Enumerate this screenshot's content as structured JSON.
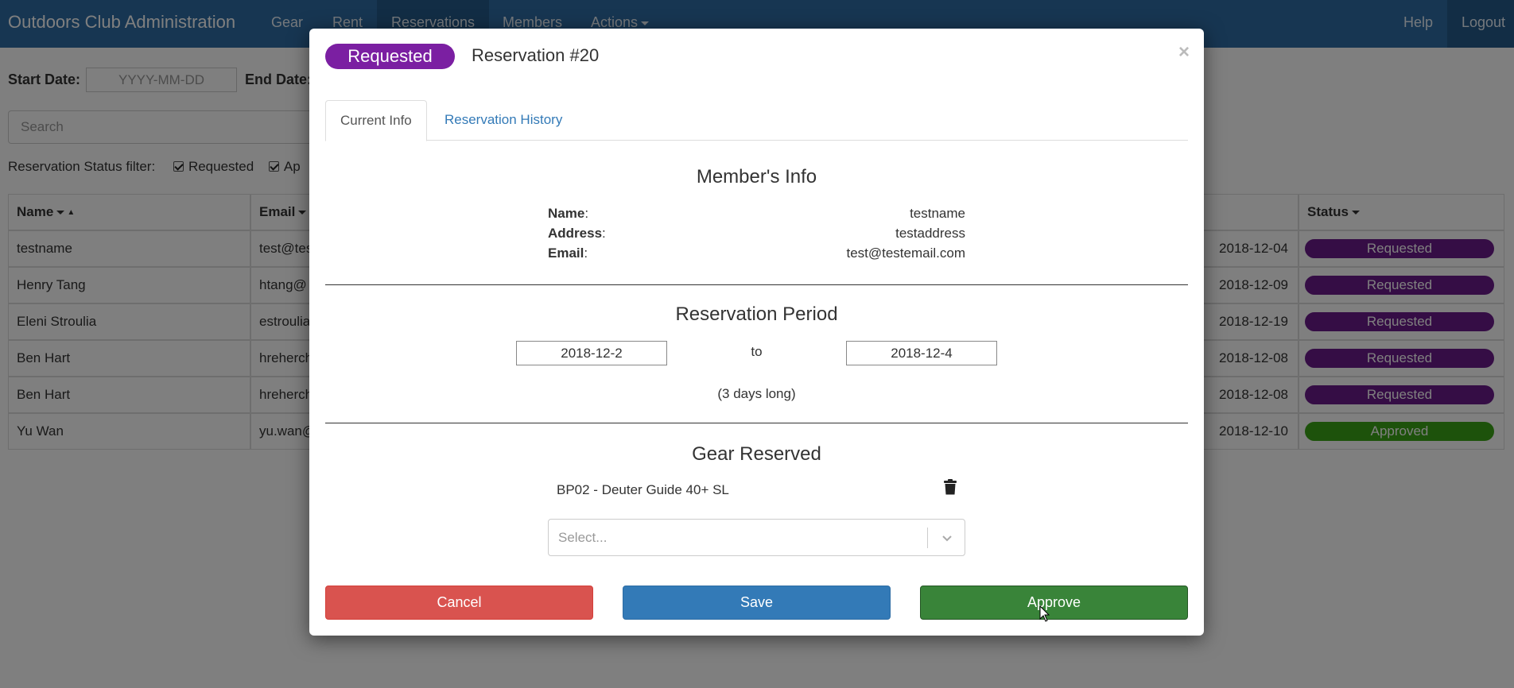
{
  "nav": {
    "brand": "Outdoors Club Administration",
    "items": [
      "Gear",
      "Rent",
      "Reservations",
      "Members",
      "Actions"
    ],
    "help": "Help",
    "logout": "Logout"
  },
  "filters": {
    "start_label": "Start Date:",
    "start_placeholder": "YYYY-MM-DD",
    "end_label": "End Date:",
    "search_placeholder": "Search",
    "status_filter_label": "Reservation Status filter:",
    "status_options": [
      "Requested",
      "Ap"
    ]
  },
  "table": {
    "headers": {
      "name": "Name",
      "email": "Email",
      "status": "Status"
    },
    "rows": [
      {
        "name": "testname",
        "email": "test@tes",
        "date": "2018-12-04",
        "status": "Requested"
      },
      {
        "name": "Henry Tang",
        "email": "htang@",
        "date": "2018-12-09",
        "status": "Requested"
      },
      {
        "name": "Eleni Stroulia",
        "email": "estroulia",
        "date": "2018-12-19",
        "status": "Requested"
      },
      {
        "name": "Ben Hart",
        "email": "hreherch",
        "date": "2018-12-08",
        "status": "Requested"
      },
      {
        "name": "Ben Hart",
        "email": "hreherch",
        "date": "2018-12-08",
        "status": "Requested"
      },
      {
        "name": "Yu Wan",
        "email": "yu.wan@",
        "date": "2018-12-10",
        "status": "Approved"
      }
    ]
  },
  "colors": {
    "requested": "#6a1b8a",
    "approved": "#3aa517",
    "navbar": "#2e6da4"
  },
  "modal": {
    "status": "Requested",
    "title": "Reservation #20",
    "close": "×",
    "tabs": {
      "current": "Current Info",
      "history": "Reservation History"
    },
    "member_title": "Member's Info",
    "member": [
      {
        "label": "Name",
        "value": "testname"
      },
      {
        "label": "Address",
        "value": "testaddress"
      },
      {
        "label": "Email",
        "value": "test@testemail.com"
      }
    ],
    "period_title": "Reservation Period",
    "start_date": "2018-12-2",
    "to": "to",
    "end_date": "2018-12-4",
    "duration": "(3 days long)",
    "gear_title": "Gear Reserved",
    "gear_items": [
      "BP02 - Deuter Guide 40+ SL"
    ],
    "select_placeholder": "Select...",
    "buttons": {
      "cancel": "Cancel",
      "save": "Save",
      "approve": "Approve"
    }
  }
}
